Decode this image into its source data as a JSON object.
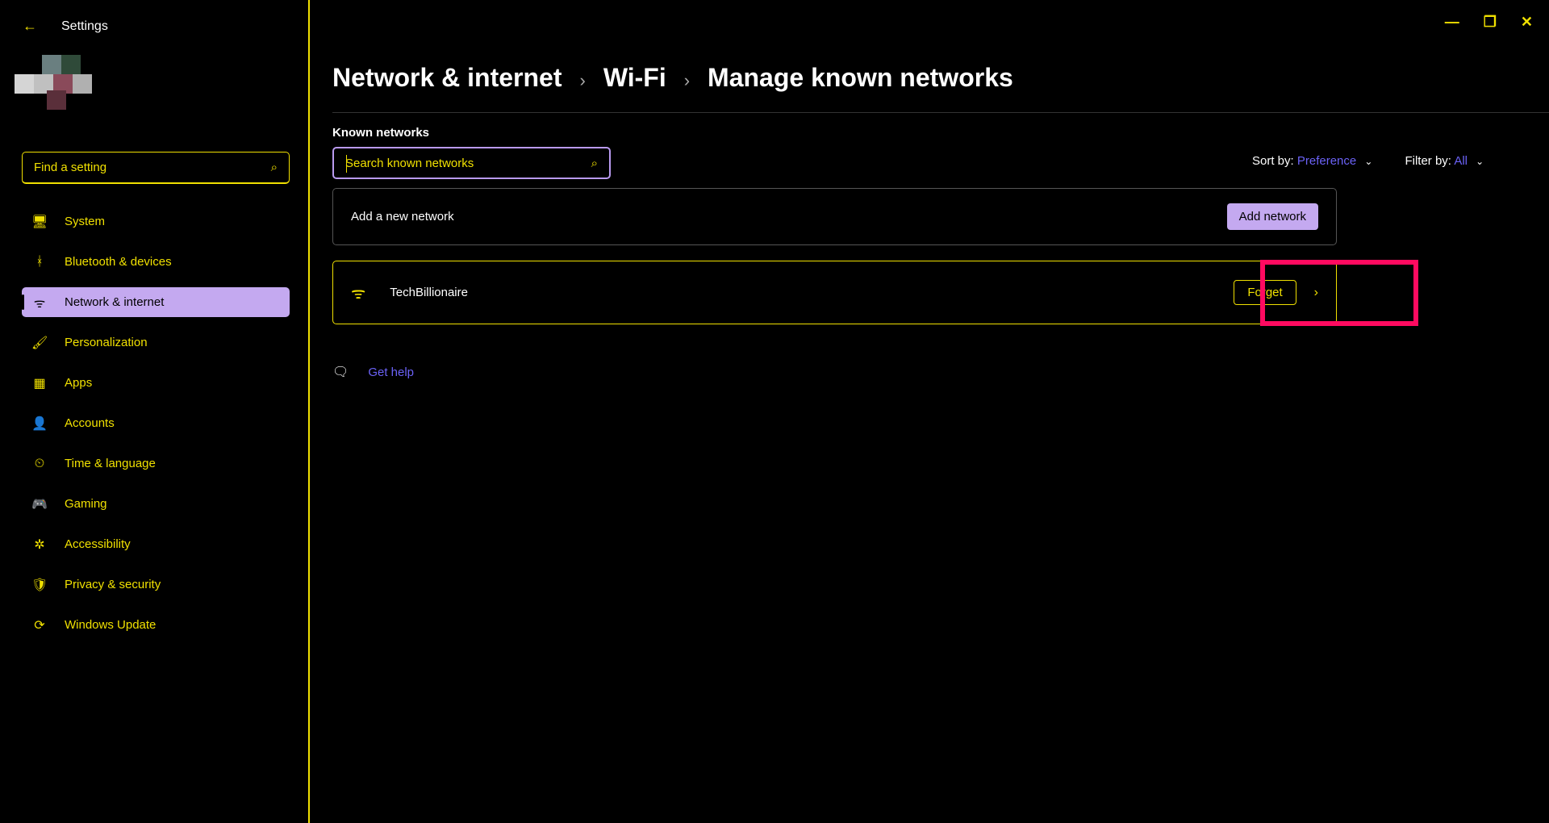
{
  "app_title": "Settings",
  "window_controls": {
    "min": "—",
    "max": "❐",
    "close": "✕"
  },
  "sidebar": {
    "search_placeholder": "Find a setting",
    "items": [
      {
        "icon": "🖥",
        "label": "System"
      },
      {
        "icon": "ᚼ",
        "label": "Bluetooth & devices"
      },
      {
        "icon": "ᯤ",
        "label": "Network & internet"
      },
      {
        "icon": "🖌",
        "label": "Personalization"
      },
      {
        "icon": "▦",
        "label": "Apps"
      },
      {
        "icon": "👤",
        "label": "Accounts"
      },
      {
        "icon": "⏲",
        "label": "Time & language"
      },
      {
        "icon": "🎮",
        "label": "Gaming"
      },
      {
        "icon": "✲",
        "label": "Accessibility"
      },
      {
        "icon": "🛡",
        "label": "Privacy & security"
      },
      {
        "icon": "⟳",
        "label": "Windows Update"
      }
    ],
    "selected_index": 2
  },
  "breadcrumb": {
    "root": "Network & internet",
    "mid": "Wi-Fi",
    "leaf": "Manage known networks"
  },
  "section_label": "Known networks",
  "known_search_placeholder": "Search known networks",
  "sort": {
    "label": "Sort by:",
    "value": "Preference"
  },
  "filter": {
    "label": "Filter by:",
    "value": "All"
  },
  "add_row": {
    "label": "Add a new network",
    "button": "Add network"
  },
  "network": {
    "name": "TechBillionaire",
    "action": "Forget"
  },
  "help": {
    "label": "Get help"
  }
}
